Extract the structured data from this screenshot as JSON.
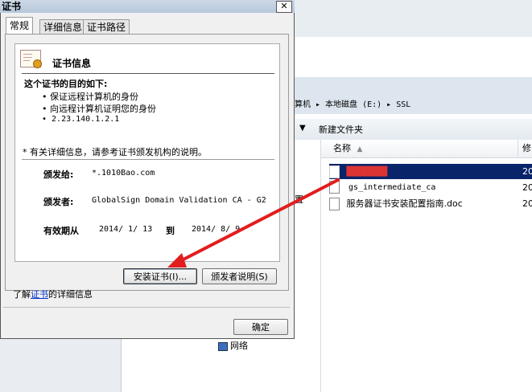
{
  "dialog": {
    "title": "证书",
    "close_label": "✕",
    "tabs": [
      {
        "label": "常规",
        "selected": true
      },
      {
        "label": "详细信息",
        "selected": false
      },
      {
        "label": "证书路径",
        "selected": false
      }
    ],
    "header": "证书信息",
    "purpose_title": "这个证书的目的如下:",
    "purposes": [
      "• 保证远程计算机的身份",
      "• 向远程计算机证明您的身份",
      "• 2.23.140.1.2.1"
    ],
    "note": "* 有关详细信息，请参考证书颁发机构的说明。",
    "issued_to_label": "颁发给:",
    "issued_to_value": "*.1010Bao.com",
    "issued_by_label": "颁发者:",
    "issued_by_value": "GlobalSign Domain Validation CA - G2",
    "validity_label": "有效期从",
    "valid_from": "2014/ 1/ 13",
    "to_label": "到",
    "valid_to": "2014/ 8/ 9",
    "install_button": "安装证书(I)...",
    "issuer_statement_button": "颁发者说明(S)",
    "learn_prefix": "了解",
    "learn_link": "证书",
    "learn_suffix": "的详细信息",
    "ok_button": "确定"
  },
  "explorer": {
    "breadcrumb": "算机 ▸ 本地磁盘 (E:) ▸ SSL",
    "new_folder": "新建文件夹",
    "col_name": "名称",
    "col_modified": "修",
    "files": [
      {
        "name": "██████",
        "date": "20",
        "selected": true
      },
      {
        "name": "gs_intermediate_ca",
        "date": "20",
        "selected": false
      },
      {
        "name": "服务器证书安装配置指南.doc",
        "date": "20",
        "selected": false
      }
    ],
    "partial_label": "置",
    "network_label": "网络"
  },
  "colors": {
    "selection": "#0a246a",
    "arrow": "#e21d1d",
    "link": "#0033cc"
  }
}
